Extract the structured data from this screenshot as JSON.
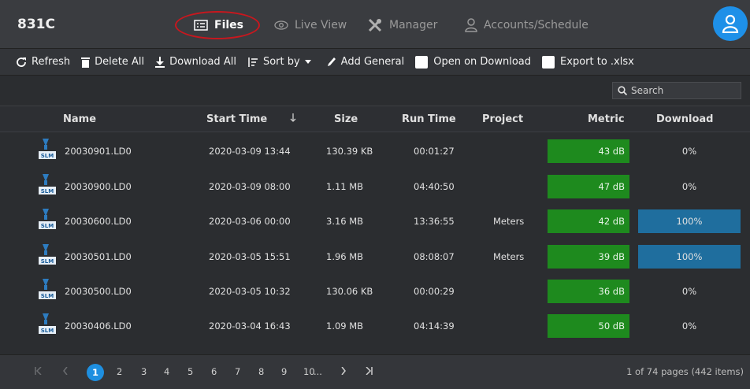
{
  "app": {
    "title": "831C"
  },
  "nav": {
    "files": "Files",
    "live_view": "Live View",
    "manager": "Manager",
    "accounts": "Accounts/Schedule"
  },
  "toolbar": {
    "refresh": "Refresh",
    "delete_all": "Delete All",
    "download_all": "Download All",
    "sort_by": "Sort by",
    "add_general": "Add General",
    "open_on_download": "Open on Download",
    "export_xlsx": "Export to .xlsx"
  },
  "search": {
    "placeholder": "Search"
  },
  "table": {
    "columns": {
      "name": "Name",
      "start_time": "Start Time",
      "size": "Size",
      "run_time": "Run Time",
      "project": "Project",
      "metric": "Metric",
      "download": "Download"
    },
    "icon_label": "SLM",
    "rows": [
      {
        "name": "20030901.LD0",
        "start": "2020-03-09 13:44",
        "size": "130.39 KB",
        "run": "00:01:27",
        "project": "",
        "metric": "43 dB",
        "download": "0%",
        "download_state": "none"
      },
      {
        "name": "20030900.LD0",
        "start": "2020-03-09 08:00",
        "size": "1.11 MB",
        "run": "04:40:50",
        "project": "",
        "metric": "47 dB",
        "download": "0%",
        "download_state": "none"
      },
      {
        "name": "20030600.LD0",
        "start": "2020-03-06 00:00",
        "size": "3.16 MB",
        "run": "13:36:55",
        "project": "Meters",
        "metric": "42 dB",
        "download": "100%",
        "download_state": "full"
      },
      {
        "name": "20030501.LD0",
        "start": "2020-03-05 15:51",
        "size": "1.96 MB",
        "run": "08:08:07",
        "project": "Meters",
        "metric": "39 dB",
        "download": "100%",
        "download_state": "full"
      },
      {
        "name": "20030500.LD0",
        "start": "2020-03-05 10:32",
        "size": "130.06 KB",
        "run": "00:00:29",
        "project": "",
        "metric": "36 dB",
        "download": "0%",
        "download_state": "none"
      },
      {
        "name": "20030406.LD0",
        "start": "2020-03-04 16:43",
        "size": "1.09 MB",
        "run": "04:14:39",
        "project": "",
        "metric": "50 dB",
        "download": "0%",
        "download_state": "none"
      }
    ]
  },
  "pagination": {
    "pages": [
      "1",
      "2",
      "3",
      "4",
      "5",
      "6",
      "7",
      "8",
      "9",
      "10"
    ],
    "current": "1",
    "ellipsis": "...",
    "summary": "1 of 74 pages (442 items)"
  },
  "colors": {
    "metric_bar": "#1e8a1e",
    "download_bar": "#1f6e9e",
    "accent": "#1e8fe0",
    "highlight_circle": "#c8171e"
  }
}
